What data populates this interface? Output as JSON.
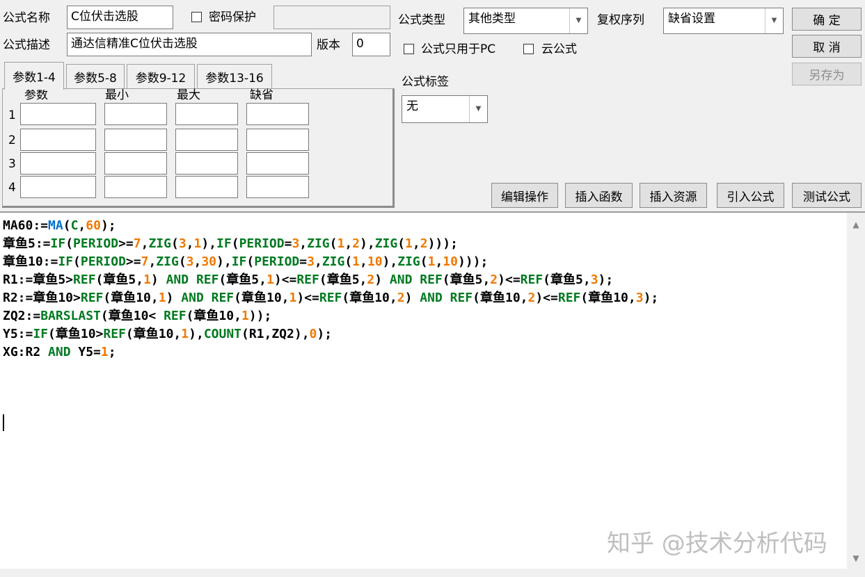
{
  "formula_name": {
    "label": "公式名称",
    "value": "C位伏击选股"
  },
  "password_protect": {
    "label": "密码保护",
    "checked": false,
    "value": ""
  },
  "formula_desc": {
    "label": "公式描述",
    "value": "通达信精准C位伏击选股"
  },
  "version": {
    "label": "版本",
    "value": "0"
  },
  "formula_type": {
    "label": "公式类型",
    "value": "其他类型"
  },
  "rights_seq": {
    "label": "复权序列",
    "value": "缺省设置"
  },
  "pc_only": {
    "label": "公式只用于PC",
    "checked": false
  },
  "cloud": {
    "label": "云公式",
    "checked": false
  },
  "formula_tag": {
    "label": "公式标签",
    "value": "无"
  },
  "buttons": {
    "ok": "确  定",
    "cancel": "取  消",
    "save_as": "另存为"
  },
  "tabs": [
    "参数1-4",
    "参数5-8",
    "参数9-12",
    "参数13-16"
  ],
  "param_headers": [
    "参数",
    "最小",
    "最大",
    "缺省"
  ],
  "param_rows": [
    "1",
    "2",
    "3",
    "4"
  ],
  "toolbar": {
    "edit": "编辑操作",
    "insert_func": "插入函数",
    "insert_res": "插入资源",
    "import": "引入公式",
    "test": "测试公式"
  },
  "code_lines": [
    [
      [
        "id",
        "MA60:="
      ],
      [
        "fn",
        "MA"
      ],
      [
        "id",
        "("
      ],
      [
        "kw",
        "C"
      ],
      [
        "id",
        ","
      ],
      [
        "num",
        "60"
      ],
      [
        "id",
        ");"
      ]
    ],
    [
      [
        "id",
        "章鱼5:="
      ],
      [
        "kw",
        "IF"
      ],
      [
        "id",
        "("
      ],
      [
        "kw",
        "PERIOD"
      ],
      [
        "id",
        ">="
      ],
      [
        "num",
        "7"
      ],
      [
        "id",
        ","
      ],
      [
        "kw",
        "ZIG"
      ],
      [
        "id",
        "("
      ],
      [
        "num",
        "3"
      ],
      [
        "id",
        ","
      ],
      [
        "num",
        "1"
      ],
      [
        "id",
        "),"
      ],
      [
        "kw",
        "IF"
      ],
      [
        "id",
        "("
      ],
      [
        "kw",
        "PERIOD"
      ],
      [
        "id",
        "="
      ],
      [
        "num",
        "3"
      ],
      [
        "id",
        ","
      ],
      [
        "kw",
        "ZIG"
      ],
      [
        "id",
        "("
      ],
      [
        "num",
        "1"
      ],
      [
        "id",
        ","
      ],
      [
        "num",
        "2"
      ],
      [
        "id",
        "),"
      ],
      [
        "kw",
        "ZIG"
      ],
      [
        "id",
        "("
      ],
      [
        "num",
        "1"
      ],
      [
        "id",
        ","
      ],
      [
        "num",
        "2"
      ],
      [
        "id",
        ")));"
      ]
    ],
    [
      [
        "id",
        "章鱼10:="
      ],
      [
        "kw",
        "IF"
      ],
      [
        "id",
        "("
      ],
      [
        "kw",
        "PERIOD"
      ],
      [
        "id",
        ">="
      ],
      [
        "num",
        "7"
      ],
      [
        "id",
        ","
      ],
      [
        "kw",
        "ZIG"
      ],
      [
        "id",
        "("
      ],
      [
        "num",
        "3"
      ],
      [
        "id",
        ","
      ],
      [
        "num",
        "30"
      ],
      [
        "id",
        "),"
      ],
      [
        "kw",
        "IF"
      ],
      [
        "id",
        "("
      ],
      [
        "kw",
        "PERIOD"
      ],
      [
        "id",
        "="
      ],
      [
        "num",
        "3"
      ],
      [
        "id",
        ","
      ],
      [
        "kw",
        "ZIG"
      ],
      [
        "id",
        "("
      ],
      [
        "num",
        "1"
      ],
      [
        "id",
        ","
      ],
      [
        "num",
        "10"
      ],
      [
        "id",
        "),"
      ],
      [
        "kw",
        "ZIG"
      ],
      [
        "id",
        "("
      ],
      [
        "num",
        "1"
      ],
      [
        "id",
        ","
      ],
      [
        "num",
        "10"
      ],
      [
        "id",
        ")));"
      ]
    ],
    [
      [
        "id",
        "R1:=章鱼5>"
      ],
      [
        "kw",
        "REF"
      ],
      [
        "id",
        "(章鱼5,"
      ],
      [
        "num",
        "1"
      ],
      [
        "id",
        ") "
      ],
      [
        "kw",
        "AND"
      ],
      [
        "id",
        " "
      ],
      [
        "kw",
        "REF"
      ],
      [
        "id",
        "(章鱼5,"
      ],
      [
        "num",
        "1"
      ],
      [
        "id",
        ")<="
      ],
      [
        "kw",
        "REF"
      ],
      [
        "id",
        "(章鱼5,"
      ],
      [
        "num",
        "2"
      ],
      [
        "id",
        ") "
      ],
      [
        "kw",
        "AND"
      ],
      [
        "id",
        " "
      ],
      [
        "kw",
        "REF"
      ],
      [
        "id",
        "(章鱼5,"
      ],
      [
        "num",
        "2"
      ],
      [
        "id",
        ")<="
      ],
      [
        "kw",
        "REF"
      ],
      [
        "id",
        "(章鱼5,"
      ],
      [
        "num",
        "3"
      ],
      [
        "id",
        ");"
      ]
    ],
    [
      [
        "id",
        "R2:=章鱼10>"
      ],
      [
        "kw",
        "REF"
      ],
      [
        "id",
        "(章鱼10,"
      ],
      [
        "num",
        "1"
      ],
      [
        "id",
        ") "
      ],
      [
        "kw",
        "AND"
      ],
      [
        "id",
        " "
      ],
      [
        "kw",
        "REF"
      ],
      [
        "id",
        "(章鱼10,"
      ],
      [
        "num",
        "1"
      ],
      [
        "id",
        ")<="
      ],
      [
        "kw",
        "REF"
      ],
      [
        "id",
        "(章鱼10,"
      ],
      [
        "num",
        "2"
      ],
      [
        "id",
        ") "
      ],
      [
        "kw",
        "AND"
      ],
      [
        "id",
        " "
      ],
      [
        "kw",
        "REF"
      ],
      [
        "id",
        "(章鱼10,"
      ],
      [
        "num",
        "2"
      ],
      [
        "id",
        ")<="
      ],
      [
        "kw",
        "REF"
      ],
      [
        "id",
        "(章鱼10,"
      ],
      [
        "num",
        "3"
      ],
      [
        "id",
        ");"
      ]
    ],
    [
      [
        "id",
        "ZQ2:="
      ],
      [
        "kw",
        "BARSLAST"
      ],
      [
        "id",
        "(章鱼10< "
      ],
      [
        "kw",
        "REF"
      ],
      [
        "id",
        "(章鱼10,"
      ],
      [
        "num",
        "1"
      ],
      [
        "id",
        "));"
      ]
    ],
    [
      [
        "id",
        "Y5:="
      ],
      [
        "kw",
        "IF"
      ],
      [
        "id",
        "(章鱼10>"
      ],
      [
        "kw",
        "REF"
      ],
      [
        "id",
        "(章鱼10,"
      ],
      [
        "num",
        "1"
      ],
      [
        "id",
        "),"
      ],
      [
        "kw",
        "COUNT"
      ],
      [
        "id",
        "(R1,ZQ2),"
      ],
      [
        "num",
        "0"
      ],
      [
        "id",
        ");"
      ]
    ],
    [
      [
        "id",
        "XG:R2 "
      ],
      [
        "kw",
        "AND"
      ],
      [
        "id",
        " Y5="
      ],
      [
        "num",
        "1"
      ],
      [
        "id",
        ";"
      ]
    ]
  ],
  "watermark": "知乎 @技术分析代码",
  "colors": {
    "keyword": "#007a20",
    "function": "#0070d0",
    "number": "#f07800"
  },
  "icons": [
    "chevron-down-icon",
    "scroll-up-icon",
    "scroll-down-icon"
  ]
}
